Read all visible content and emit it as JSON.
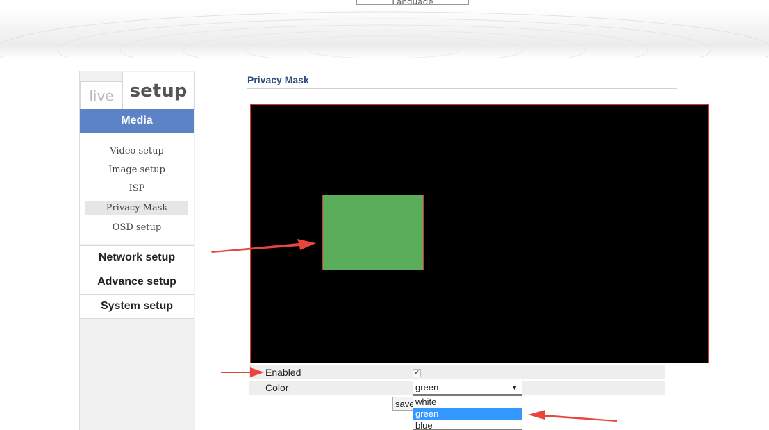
{
  "header": {
    "language_label": "Language"
  },
  "tabs": {
    "live": "live",
    "setup": "setup"
  },
  "sidebar": {
    "media_label": "Media",
    "media_items": [
      {
        "label": "Video setup"
      },
      {
        "label": "Image setup"
      },
      {
        "label": "ISP"
      },
      {
        "label": "Privacy Mask",
        "active": true
      },
      {
        "label": "OSD setup"
      }
    ],
    "sections": [
      {
        "label": "Network setup"
      },
      {
        "label": "Advance setup"
      },
      {
        "label": "System setup"
      }
    ]
  },
  "main": {
    "title": "Privacy Mask",
    "enabled_label": "Enabled",
    "enabled_checked": true,
    "color_label": "Color",
    "color_value": "green",
    "color_options": [
      "white",
      "green",
      "blue"
    ],
    "save_label": "save"
  },
  "colors": {
    "accent": "#5b83c6",
    "mask": "#5aad5a",
    "annotation_arrow": "#e8453c",
    "selected_option": "#3399ff"
  }
}
